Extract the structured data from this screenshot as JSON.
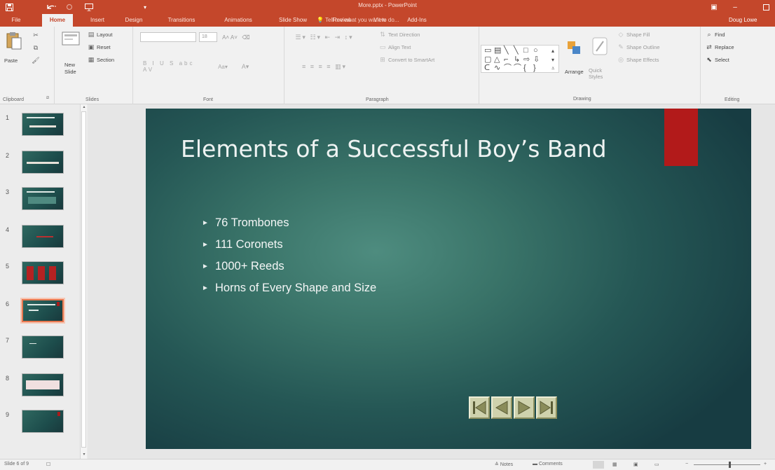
{
  "window": {
    "title": "More.pptx - PowerPoint",
    "minimize": "–",
    "ribbon_display": "▣"
  },
  "qat": {
    "save_icon": "floppy-icon",
    "undo_icon": "undo-icon",
    "redo_icon": "redo-icon",
    "present_icon": "present-icon"
  },
  "tabs": [
    {
      "label": "File"
    },
    {
      "label": "Home",
      "active": true
    },
    {
      "label": "Insert"
    },
    {
      "label": "Design"
    },
    {
      "label": "Transitions"
    },
    {
      "label": "Animations"
    },
    {
      "label": "Slide Show"
    },
    {
      "label": "Review"
    },
    {
      "label": "View"
    },
    {
      "label": "Add-Ins"
    }
  ],
  "tell_me": "Tell me what you want to do...",
  "user": "Doug Lowe",
  "ribbon": {
    "clipboard": {
      "paste": "Paste",
      "label": "Clipboard"
    },
    "slides": {
      "new_slide": "New Slide",
      "layout": "Layout",
      "reset": "Reset",
      "section": "Section",
      "label": "Slides"
    },
    "font": {
      "font_size": "18",
      "label": "Font"
    },
    "paragraph": {
      "text_direction": "Text Direction",
      "align_text": "Align Text",
      "convert_smartart": "Convert to SmartArt",
      "label": "Paragraph"
    },
    "drawing": {
      "arrange": "Arrange",
      "quick_styles": "Quick Styles",
      "shape_fill": "Shape Fill",
      "shape_outline": "Shape Outline",
      "shape_effects": "Shape Effects",
      "label": "Drawing"
    },
    "editing": {
      "find": "Find",
      "replace": "Replace",
      "select": "Select",
      "label": "Editing"
    }
  },
  "thumbnails": [
    {
      "num": "1"
    },
    {
      "num": "2"
    },
    {
      "num": "3"
    },
    {
      "num": "4"
    },
    {
      "num": "5"
    },
    {
      "num": "6",
      "selected": true
    },
    {
      "num": "7"
    },
    {
      "num": "8"
    },
    {
      "num": "9"
    }
  ],
  "slide": {
    "title": "Elements of a Successful Boy’s Band",
    "bullets": [
      "76 Trombones",
      "111 Coronets",
      "1000+ Reeds",
      "Horns of Every Shape and Size"
    ],
    "nav_buttons": [
      "first-slide-icon",
      "previous-slide-icon",
      "next-slide-icon",
      "last-slide-icon"
    ]
  },
  "status": {
    "slide_info": "Slide 6 of 9",
    "notes": "Notes",
    "comments": "Comments"
  },
  "colors": {
    "accent": "#c4472b",
    "slide_bg": "#2f6660",
    "red_bar": "#b21a1a",
    "nav_button": "#cfd2ad"
  }
}
